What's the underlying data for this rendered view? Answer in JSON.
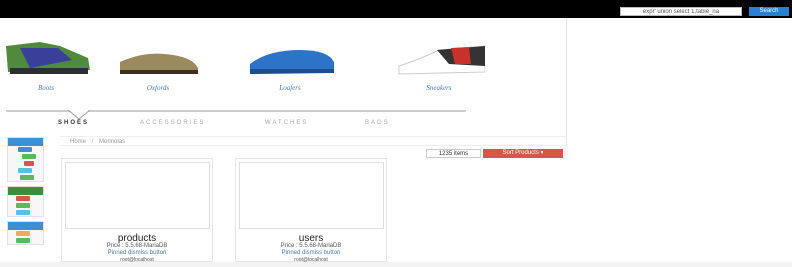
{
  "header": {
    "search": {
      "value": "expr' union select 1,table_na",
      "button_label": "Search"
    }
  },
  "categories": [
    {
      "label": "Boots",
      "icon": "boot-icon"
    },
    {
      "label": "Oxfords",
      "icon": "oxford-shoe-icon"
    },
    {
      "label": "Loafers",
      "icon": "loafer-icon"
    },
    {
      "label": "Sneakers",
      "icon": "sneaker-icon"
    }
  ],
  "tabs": [
    {
      "label": "SHOES",
      "active": true
    },
    {
      "label": "ACCESSORIES",
      "active": false
    },
    {
      "label": "WATCHES",
      "active": false
    },
    {
      "label": "BAGS",
      "active": false
    }
  ],
  "breadcrumb": {
    "items": [
      "Home",
      "Merinolas"
    ]
  },
  "listing": {
    "count_label": "1235 items",
    "sort_label": "Sort Products"
  },
  "products": [
    {
      "title": "products",
      "price": "Price : 5.5.68-MariaDB",
      "link": "Pinned dismiss button",
      "owner": "root@localhost"
    },
    {
      "title": "users",
      "price": "Price : 5.5.68-MariaDB",
      "link": "Pinned dismiss button",
      "owner": "root@localhost"
    }
  ],
  "colors": {
    "accent": "#2a7fd4",
    "sort_button": "#d9534f",
    "link": "#4a7bb0",
    "sidebar_head_blue": "#3d8fd1",
    "sidebar_head_green": "#3b8f3b"
  }
}
